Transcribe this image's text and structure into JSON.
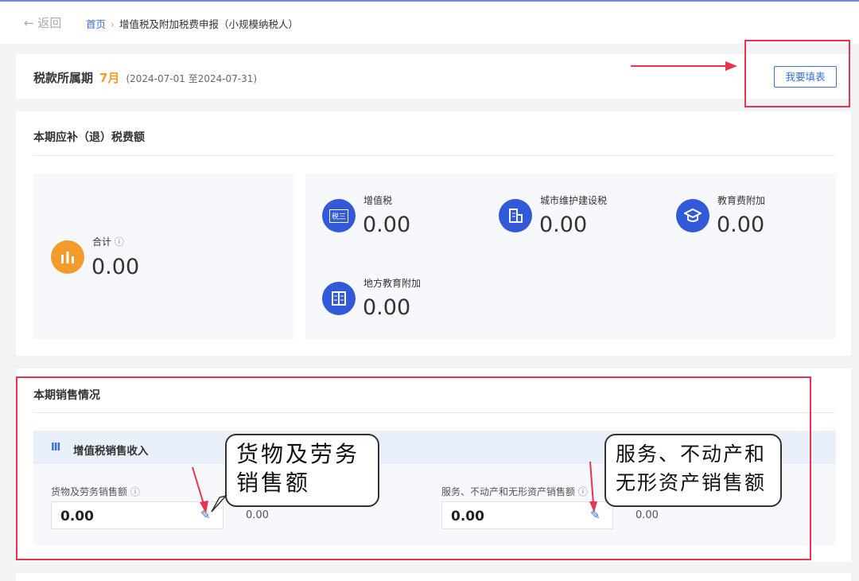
{
  "nav": {
    "back": "← 返回",
    "home": "首页",
    "sep": "›",
    "current": "增值税及附加税费申报（小规模纳税人）"
  },
  "period": {
    "label": "税款所属期",
    "month": "7月",
    "range": "(2024-07-01 至2024-07-31)",
    "fill_button": "我要填表"
  },
  "due": {
    "title": "本期应补（退）税费额",
    "total_label": "合计",
    "total_value": "0.00",
    "items": [
      {
        "label": "增值税",
        "value": "0.00",
        "icon": "tax-doc-icon"
      },
      {
        "label": "城市维护建设税",
        "value": "0.00",
        "icon": "building-icon"
      },
      {
        "label": "教育费附加",
        "value": "0.00",
        "icon": "graduation-cap-icon"
      },
      {
        "label": "地方教育附加",
        "value": "0.00",
        "icon": "book-icon"
      }
    ]
  },
  "sales": {
    "title": "本期销售情况",
    "section": "增值税销售收入",
    "fields": [
      {
        "label": "货物及劳务销售额",
        "value": "0.00",
        "aside": "0.00"
      },
      {
        "label": "服务、不动产和无形资产销售额",
        "value": "0.00",
        "aside": "0.00"
      }
    ]
  },
  "callouts": [
    "货物及劳务\n销售额",
    "服务、不动产和\n无形资产销售额"
  ],
  "colors": {
    "accent": "#3159d8",
    "highlight": "#e8344e",
    "orange": "#f39c2c"
  }
}
